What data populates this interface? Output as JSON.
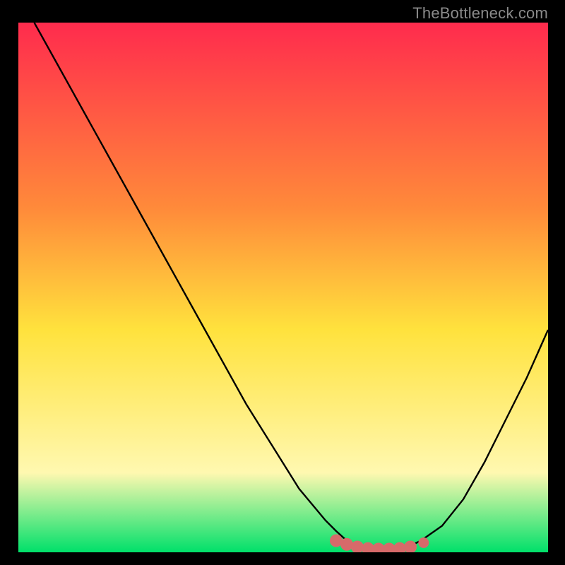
{
  "watermark": "TheBottleneck.com",
  "colors": {
    "frame": "#000000",
    "grad_top": "#ff2b4d",
    "grad_mid_upper": "#ff8a3a",
    "grad_mid": "#ffe23d",
    "grad_lower": "#fff8b0",
    "grad_bottom": "#00e06a",
    "curve": "#000000",
    "marker_fill": "#d76a6a",
    "marker_stroke": "#d76a6a"
  },
  "chart_data": {
    "type": "line",
    "title": "",
    "xlabel": "",
    "ylabel": "",
    "xlim": [
      0,
      100
    ],
    "ylim": [
      0,
      100
    ],
    "series": [
      {
        "name": "bottleneck-curve",
        "x": [
          3,
          8,
          13,
          18,
          23,
          28,
          33,
          38,
          43,
          48,
          53,
          58,
          60,
          62,
          64,
          66,
          68,
          70,
          72,
          74,
          76,
          80,
          84,
          88,
          92,
          96,
          100
        ],
        "y": [
          100,
          91,
          82,
          73,
          64,
          55,
          46,
          37,
          28,
          20,
          12,
          6,
          4,
          2.2,
          1.2,
          0.6,
          0.3,
          0.3,
          0.6,
          1.2,
          2.2,
          5,
          10,
          17,
          25,
          33,
          42
        ]
      }
    ],
    "markers": {
      "name": "optimal-range",
      "points": [
        {
          "x": 60,
          "y": 2.2
        },
        {
          "x": 62,
          "y": 1.5
        },
        {
          "x": 64,
          "y": 1.0
        },
        {
          "x": 66,
          "y": 0.7
        },
        {
          "x": 68,
          "y": 0.6
        },
        {
          "x": 70,
          "y": 0.6
        },
        {
          "x": 72,
          "y": 0.7
        },
        {
          "x": 74,
          "y": 1.0
        },
        {
          "x": 76.5,
          "y": 1.8
        }
      ]
    }
  }
}
